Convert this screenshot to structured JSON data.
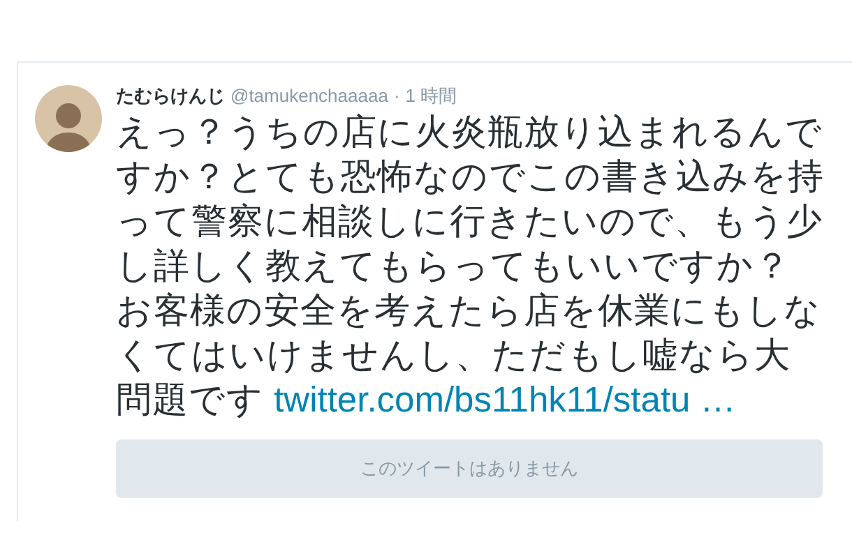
{
  "tweet": {
    "display_name": "たむらけんじ",
    "handle": "@tamukenchaaaaa",
    "separator": "·",
    "time": "1 時間",
    "text": "えっ？うちの店に火炎瓶放り込まれるんですか？とても恐怖なのでこの書き込みを持って警察に相談しに行きたいので、もう少し詳しく教えてもらってもいいですか？お客様の安全を考えたら店を休業にもしなくてはいけませんし、ただもし嘘なら大問題です",
    "link": "twitter.com/bs11hk11/statu …",
    "quoted_tweet": {
      "message": "このツイートはありません"
    }
  }
}
